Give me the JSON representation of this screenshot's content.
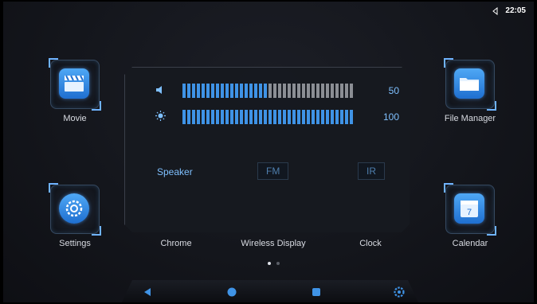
{
  "status_bar": {
    "icon": "volume-icon",
    "time": "22:05"
  },
  "apps": {
    "movie": {
      "label": "Movie",
      "icon": "movie-clapper-icon"
    },
    "file_manager": {
      "label": "File Manager",
      "icon": "folder-icon"
    },
    "settings": {
      "label": "Settings",
      "icon": "gear-icon"
    },
    "calendar": {
      "label": "Calendar",
      "icon": "calendar-icon",
      "day": "7"
    },
    "chrome": {
      "label": "Chrome"
    },
    "wireless_display": {
      "label": "Wireless Display"
    },
    "clock": {
      "label": "Clock"
    }
  },
  "panel": {
    "volume": {
      "icon": "speaker-icon",
      "value": "50",
      "level": 0.5
    },
    "brightness": {
      "icon": "brightness-icon",
      "value": "100",
      "level": 1.0
    },
    "options": {
      "speaker": "Speaker",
      "fm": "FM",
      "ir": "IR"
    }
  },
  "pager": {
    "pages": 2,
    "active": 0
  },
  "nav": {
    "back": "back-icon",
    "home": "home-icon",
    "recents": "recents-icon",
    "settings": "settings-icon"
  },
  "colors": {
    "accent": "#3f93e6",
    "accent_text": "#7fc0ff",
    "inactive_segment": "#8b8e94"
  }
}
